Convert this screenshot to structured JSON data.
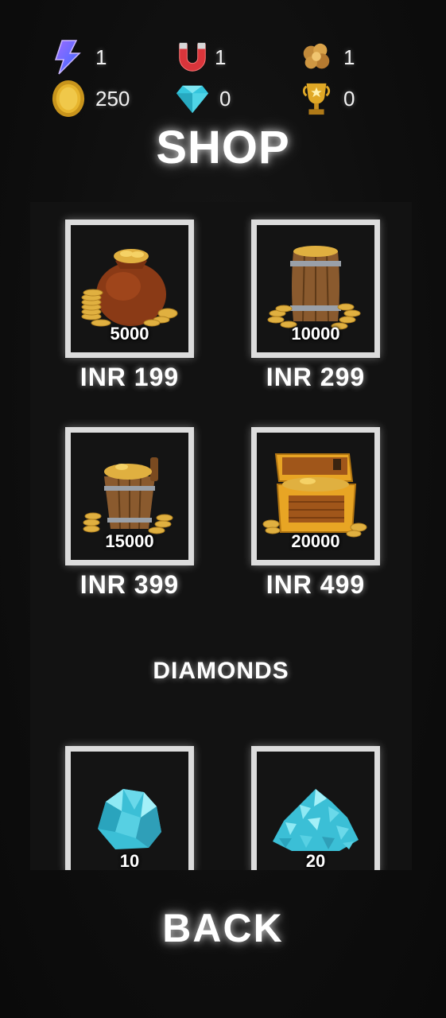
{
  "stats": {
    "energy": {
      "value": "1",
      "icon": "lightning-bolt-icon"
    },
    "magnet": {
      "value": "1",
      "icon": "magnet-icon"
    },
    "explosion": {
      "value": "1",
      "icon": "explosion-icon"
    },
    "coins": {
      "value": "250",
      "icon": "gold-coin-icon"
    },
    "diamonds": {
      "value": "0",
      "icon": "diamond-icon"
    },
    "trophies": {
      "value": "0",
      "icon": "trophy-icon"
    }
  },
  "title": "SHOP",
  "coin_packs": [
    {
      "amount": "5000",
      "price": "INR 199",
      "icon": "coin-bag-icon"
    },
    {
      "amount": "10000",
      "price": "INR 299",
      "icon": "coin-barrel-icon"
    },
    {
      "amount": "15000",
      "price": "INR 399",
      "icon": "coin-bucket-icon"
    },
    {
      "amount": "20000",
      "price": "INR 499",
      "icon": "treasure-chest-icon"
    }
  ],
  "diamonds_section": {
    "label": "DIAMONDS",
    "packs": [
      {
        "amount": "10",
        "icon": "diamond-pile-small-icon"
      },
      {
        "amount": "20",
        "icon": "diamond-pile-large-icon"
      }
    ]
  },
  "back_label": "BACK",
  "colors": {
    "background": "#0d0d0d",
    "card_border": "#dcdcdc",
    "gold": "#e0a826",
    "diamond": "#4fd4e6"
  }
}
